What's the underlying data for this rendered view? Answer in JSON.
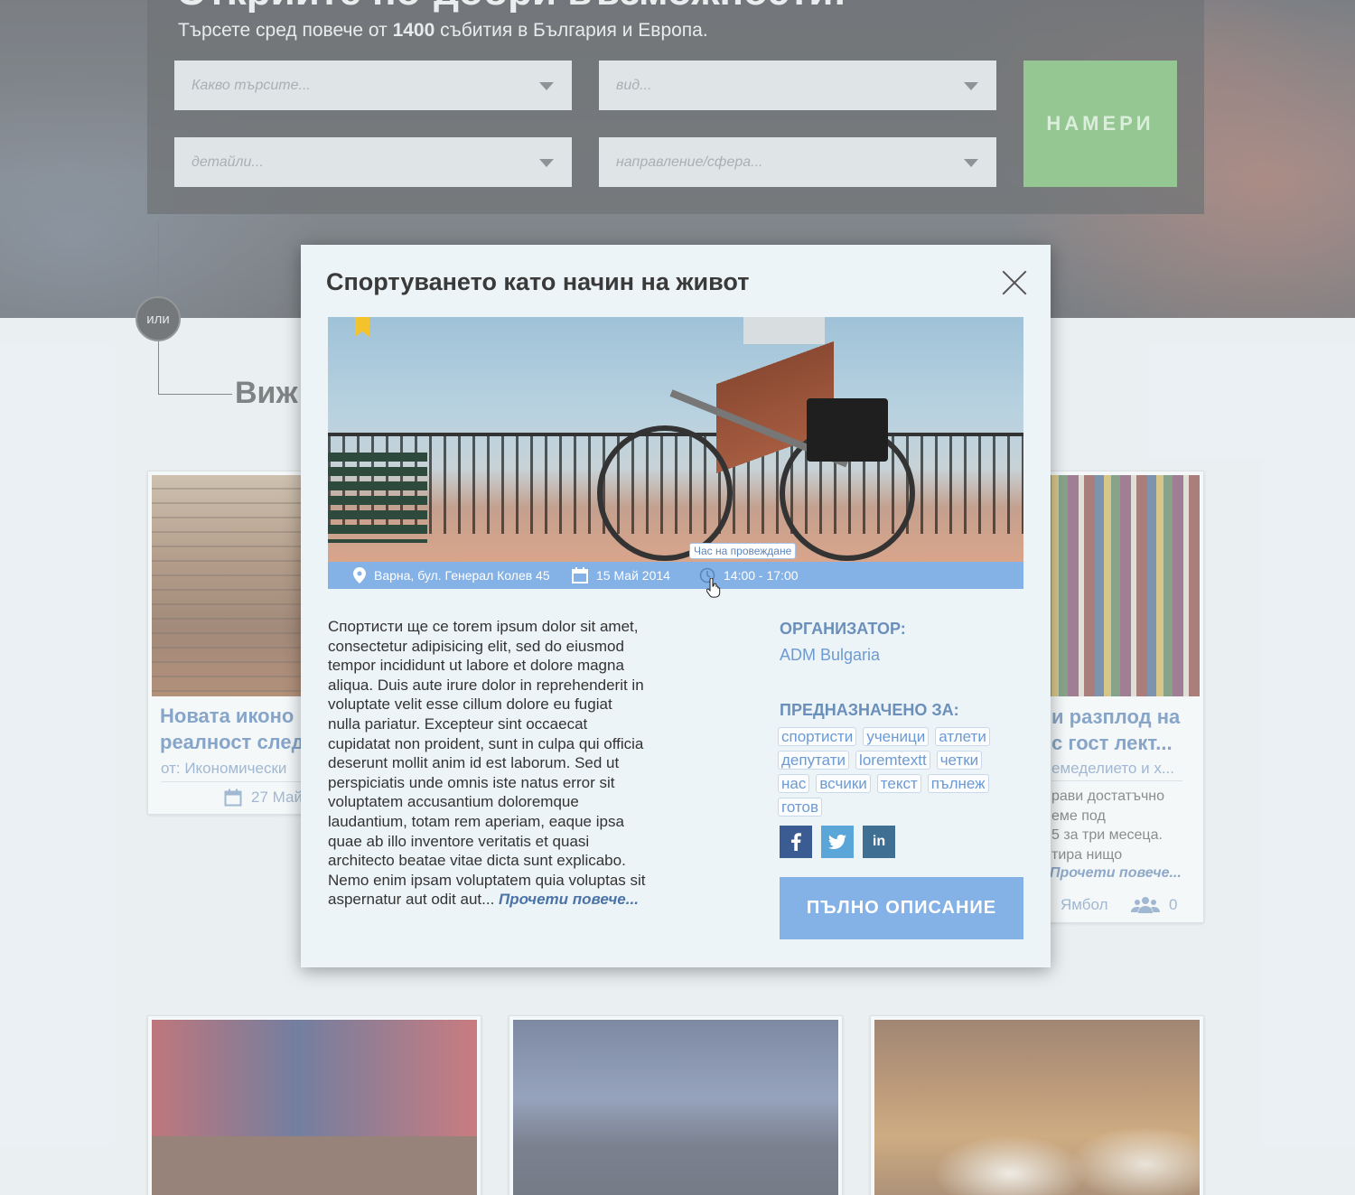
{
  "hero": {
    "title": "Открийте по-добри възможности!",
    "subtitle_prefix": "Търсете сред повече от ",
    "subtitle_count": "1400",
    "subtitle_suffix": " събития в България и Европа.",
    "fields": [
      {
        "placeholder": "Какво търсите..."
      },
      {
        "placeholder": "вид..."
      },
      {
        "placeholder": "детайли..."
      },
      {
        "placeholder": "направление/сфера..."
      }
    ],
    "search_button": "НАМЕРИ"
  },
  "divider_or": "или",
  "section_title": "Виж",
  "cards": [
    {
      "title_line1": "Новата иконо",
      "title_line2": "реалност след",
      "org": "от: Икономически",
      "date": "27 Май"
    },
    {
      "title_line1": "и разплод на",
      "title_line2": "с гост лект...",
      "org": "емеделието и х...",
      "text": [
        "рави достатъчно",
        "еме под",
        "5 за три месеца.",
        "тира нищо"
      ],
      "more": "Прочети повече...",
      "city": "Ямбол",
      "count": "0"
    }
  ],
  "modal": {
    "title": "Спортуването като начин на живот",
    "location": "Варна, бул. Генерал Колев 45",
    "date": "15 Май 2014",
    "time": "14:00 - 17:00",
    "time_tooltip": "Час на провеждане",
    "description_lines": [
      "Спортисти ще се torem ipsum dolor sit amet,",
      "consectetur adipisicing elit, sed do eiusmod",
      "tempor incididunt ut labore et dolore magna",
      "aliqua. Duis aute irure dolor in reprehenderit in",
      "voluptate velit esse cillum dolore eu fugiat",
      "nulla pariatur. Excepteur sint occaecat",
      "cupidatat non proident, sunt in culpa qui officia",
      "deserunt mollit anim id est laborum. Sed ut",
      "perspiciatis unde omnis iste natus error sit",
      "voluptatem accusantium doloremque",
      "laudantium, totam rem aperiam, eaque ipsa",
      "quae ab illo inventore veritatis et quasi",
      "architecto beatae vitae dicta sunt explicabo.",
      "Nemo enim ipsam voluptatem quia voluptas sit"
    ],
    "description_last": "aspernatur aut odit aut... ",
    "read_more": "Прочети повече...",
    "organizer_label": "ОРГАНИЗАТОР:",
    "organizer_name": "ADM Bulgaria",
    "audience_label": "ПРЕДНАЗНАЧЕНО ЗА:",
    "tags": [
      [
        "спортисти",
        "ученици",
        "атлети"
      ],
      [
        "депутати",
        "loremtextt",
        "четки"
      ],
      [
        "нас",
        "всчики",
        "текст",
        "пълнеж"
      ],
      [
        "готов"
      ]
    ],
    "social": [
      {
        "label": "f",
        "icon": "facebook-icon",
        "color": "#3b5b93"
      },
      {
        "label": "t",
        "icon": "twitter-icon",
        "color": "#5aa6d8"
      },
      {
        "label": "in",
        "icon": "linkedin-icon",
        "color": "#3f6f92"
      }
    ],
    "full_button": "ПЪЛНО ОПИСАНИЕ"
  }
}
